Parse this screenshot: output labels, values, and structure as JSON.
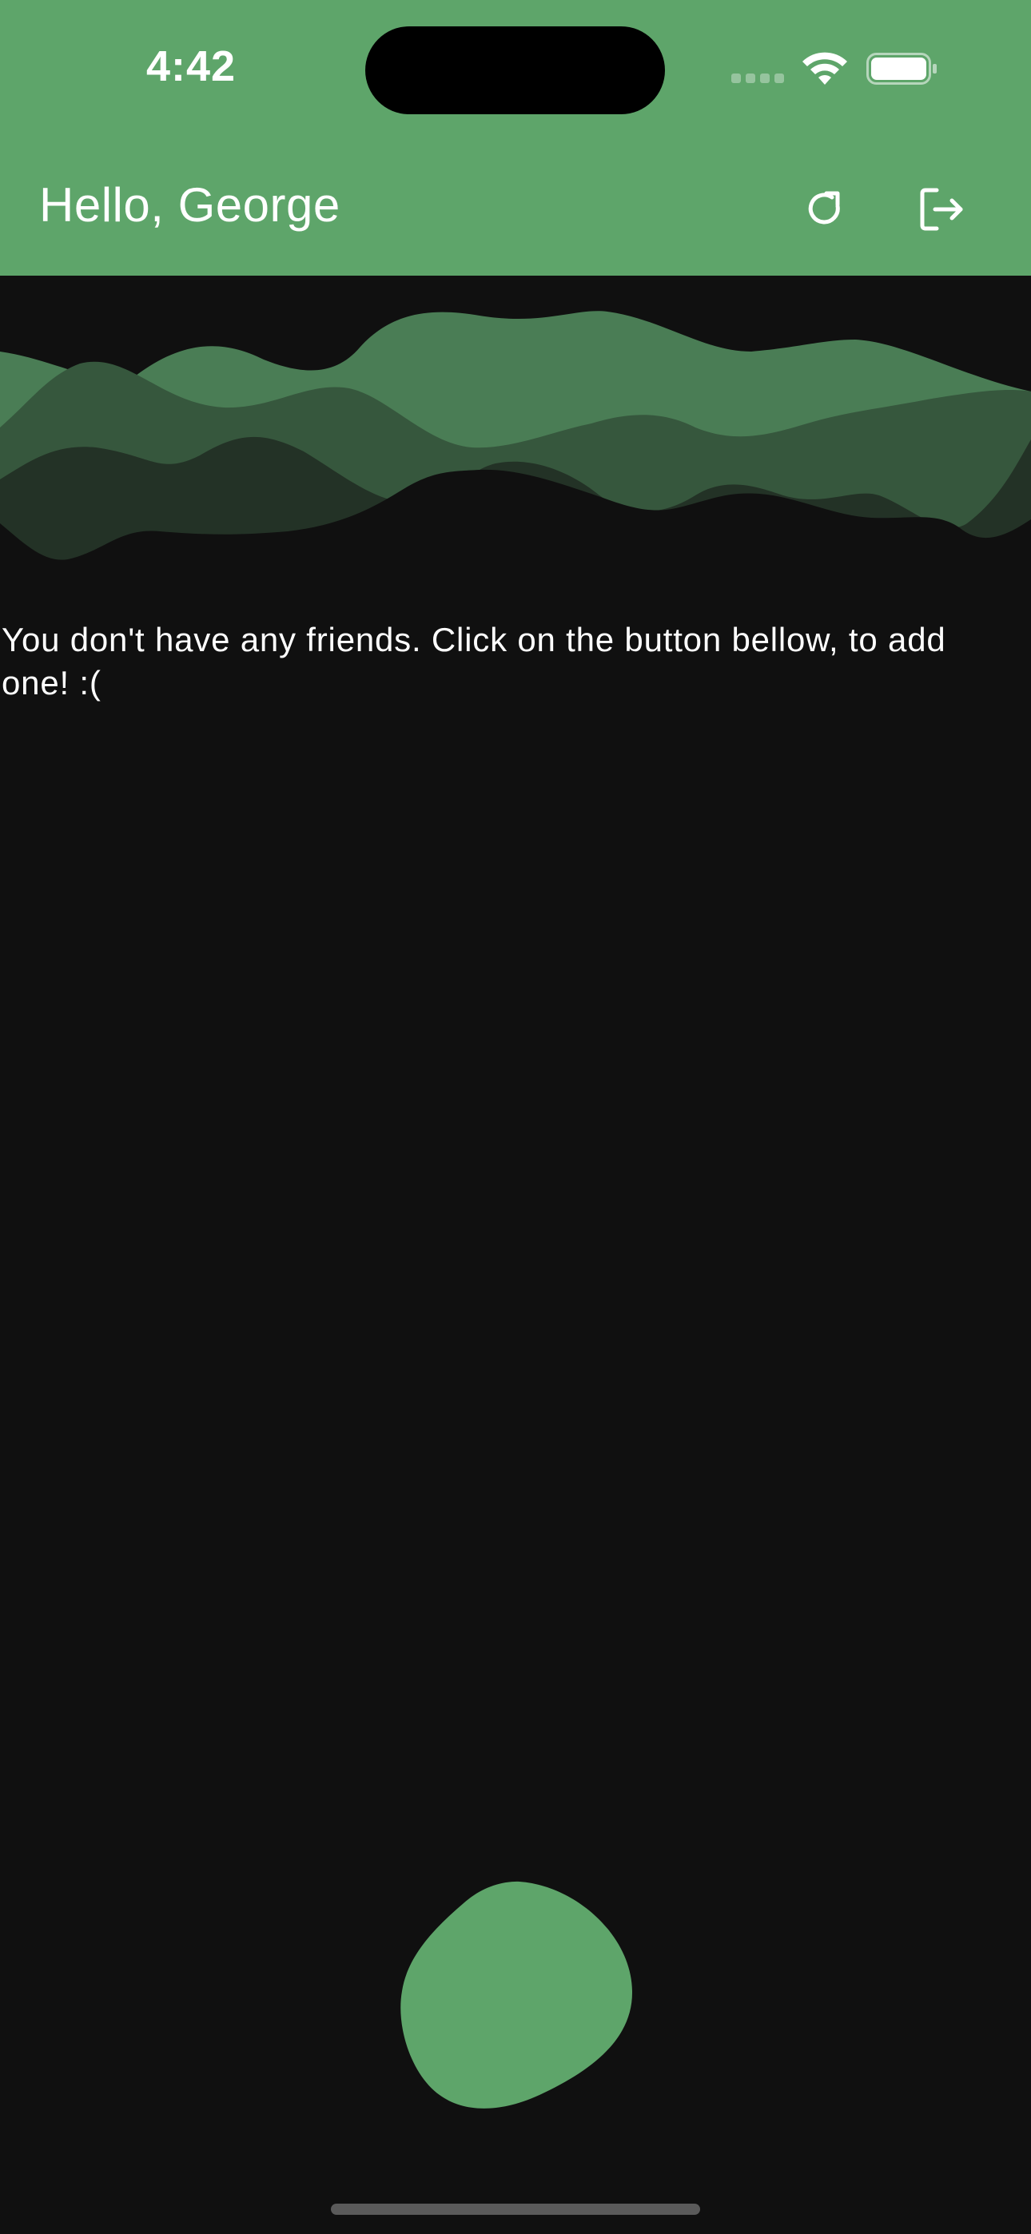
{
  "status_bar": {
    "time": "4:42"
  },
  "header": {
    "greeting": "Hello, George",
    "refresh_icon": "refresh-icon",
    "logout_icon": "logout-icon"
  },
  "main": {
    "empty_message": "You don't have any friends. Click on the button bellow, to add one! :("
  },
  "colors": {
    "accent": "#5ea56a",
    "wave_mid": "#4a7d55",
    "wave_dark": "#36573d",
    "wave_darkest": "#233226",
    "background": "#101010",
    "text": "#ffffff"
  }
}
